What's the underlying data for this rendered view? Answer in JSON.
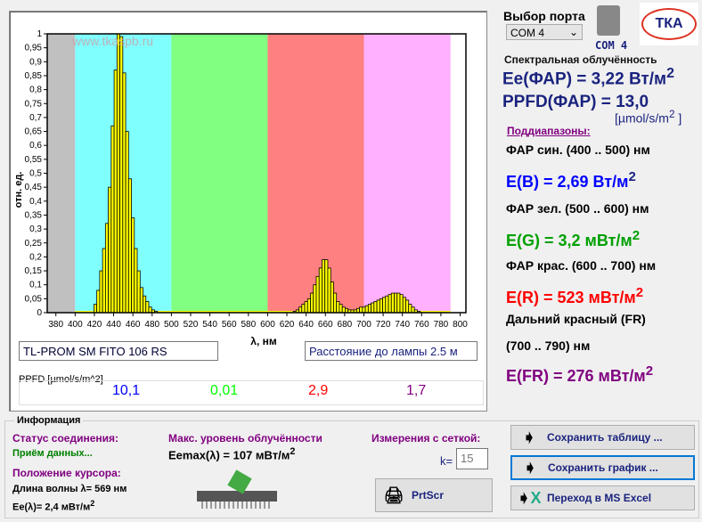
{
  "chart_data": {
    "type": "bar",
    "ylabel": "отн. ед.",
    "xlabel": "λ, нм",
    "watermark": "www.tkaspb.ru",
    "xlim": [
      371,
      806
    ],
    "ylim": [
      0,
      1
    ],
    "xticks": [
      380,
      400,
      420,
      440,
      460,
      480,
      500,
      520,
      540,
      560,
      580,
      600,
      620,
      640,
      660,
      680,
      700,
      720,
      740,
      760,
      780,
      800
    ],
    "yticks": [
      "0",
      "0,05",
      "0,1",
      "0,15",
      "0,2",
      "0,25",
      "0,3",
      "0,35",
      "0,4",
      "0,45",
      "0,5",
      "0,55",
      "0,6",
      "0,65",
      "0,7",
      "0,75",
      "0,8",
      "0,85",
      "0,9",
      "0,95",
      "1"
    ],
    "bands": [
      {
        "from": 371,
        "to": 400,
        "color": "#c0c0c0"
      },
      {
        "from": 400,
        "to": 500,
        "color": "#80ffff"
      },
      {
        "from": 500,
        "to": 600,
        "color": "#80ff80"
      },
      {
        "from": 600,
        "to": 700,
        "color": "#ff8080"
      },
      {
        "from": 700,
        "to": 790,
        "color": "#ffb0ff"
      }
    ],
    "bar_width_nm": 3,
    "x": [
      421,
      424,
      427,
      430,
      433,
      436,
      439,
      442,
      445,
      448,
      451,
      454,
      457,
      460,
      463,
      466,
      469,
      472,
      475,
      478,
      481,
      484,
      628,
      631,
      634,
      637,
      640,
      643,
      646,
      649,
      652,
      655,
      658,
      661,
      664,
      667,
      670,
      673,
      676,
      679,
      682,
      685,
      688,
      691,
      694,
      697,
      700,
      703,
      706,
      709,
      712,
      715,
      718,
      721,
      724,
      727,
      730,
      733,
      736,
      739,
      742,
      745,
      748,
      751,
      754,
      757
    ],
    "values": [
      0.03,
      0.08,
      0.15,
      0.23,
      0.32,
      0.45,
      0.67,
      0.87,
      1.0,
      0.99,
      0.86,
      0.65,
      0.48,
      0.34,
      0.23,
      0.15,
      0.09,
      0.06,
      0.04,
      0.02,
      0.01,
      0.005,
      0.005,
      0.01,
      0.02,
      0.03,
      0.04,
      0.05,
      0.07,
      0.1,
      0.13,
      0.16,
      0.19,
      0.19,
      0.16,
      0.11,
      0.07,
      0.04,
      0.03,
      0.02,
      0.015,
      0.01,
      0.01,
      0.01,
      0.015,
      0.02,
      0.02,
      0.025,
      0.03,
      0.035,
      0.04,
      0.045,
      0.05,
      0.055,
      0.06,
      0.065,
      0.07,
      0.07,
      0.07,
      0.065,
      0.055,
      0.045,
      0.03,
      0.02,
      0.01,
      0.005
    ]
  },
  "lamp_name": "TL-PROM SM FITO 106 RS",
  "distance": "Расстояние до лампы 2.5 м",
  "ppfd": {
    "label": "PPFD [µmol/s/m^2]",
    "values": [
      {
        "v": "10,1",
        "color": "#0000ff"
      },
      {
        "v": "0,01",
        "color": "#00ff00"
      },
      {
        "v": "2,9",
        "color": "#ff0000"
      },
      {
        "v": "1,7",
        "color": "#800080"
      }
    ]
  },
  "port": {
    "label": "Выбор порта",
    "selected": "COM 4",
    "status": "COM 4"
  },
  "logo": "ТКА",
  "right": {
    "title": "Спектральная облучённость",
    "ee": "Ee(ФАР) = 3,22 Вт/м",
    "ppfd": "PPFD(ФАР) = 13,0",
    "ppfd_unit": "[µmol/s/m",
    "sup": "2",
    "subranges": "Поддиапазоны:",
    "blue_label": "ФАР син. (400 .. 500) нм",
    "blue_val": "E(B) = 2,69 Вт/м",
    "green_label": "ФАР зел. (500 .. 600) нм",
    "green_val": "E(G) = 3,2 мВт/м",
    "red_label": "ФАР крас. (600 .. 700) нм",
    "red_val": "E(R) = 523 мВт/м",
    "fr_label1": "Дальний красный (FR)",
    "fr_label2": "(700 .. 790) нм",
    "fr_val": "E(FR) = 276 мВт/м"
  },
  "info": {
    "title": "Информация",
    "status_label": "Статус соединения:",
    "status": "Приём данных...",
    "cursor_label": "Положение курсора:",
    "wavelength": "Длина волны λ= 569 нм",
    "ee": "Ee(λ)= 2,4 мВт/м",
    "max_label": "Макс. уровень облучённости",
    "max": "Eemax(λ) = 107 мВт/м",
    "grid_label": "Измерения с сеткой:",
    "k_label": "k=",
    "k": "15"
  },
  "buttons": {
    "save_table": "Сохранить таблицу ...",
    "save_graph": "Сохранить график ...",
    "excel": "Переход в MS Excel",
    "prtscr": "PrtScr"
  }
}
